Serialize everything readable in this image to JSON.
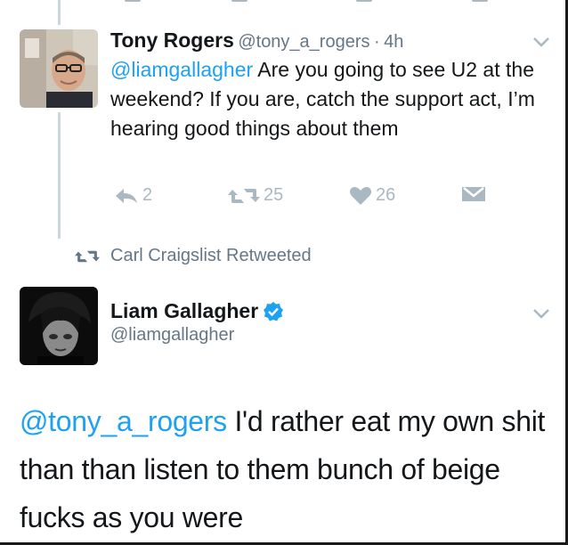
{
  "tweet_reply": {
    "author_name": "Tony Rogers",
    "author_handle": "@tony_a_rogers",
    "separator": "·",
    "time": "4h",
    "mention": "@liamgallagher",
    "text": " Are you going to see U2 at the weekend? If you are, catch the support act, I’m hearing good things about them",
    "reply_count": "2",
    "retweet_count": "25",
    "like_count": "26"
  },
  "retweet_context": {
    "label": "Carl Craigslist Retweeted"
  },
  "tweet_main": {
    "author_name": "Liam Gallagher",
    "author_handle": "@liamgallagher",
    "verified": true,
    "mention": "@tony_a_rogers",
    "text": " I'd rather eat my own shit than than listen to them bunch of beige fucks as you were"
  },
  "colors": {
    "link": "#1da1f2",
    "muted": "#657786",
    "action_gray": "#aab8c2",
    "verified_blue": "#1da1f2"
  }
}
